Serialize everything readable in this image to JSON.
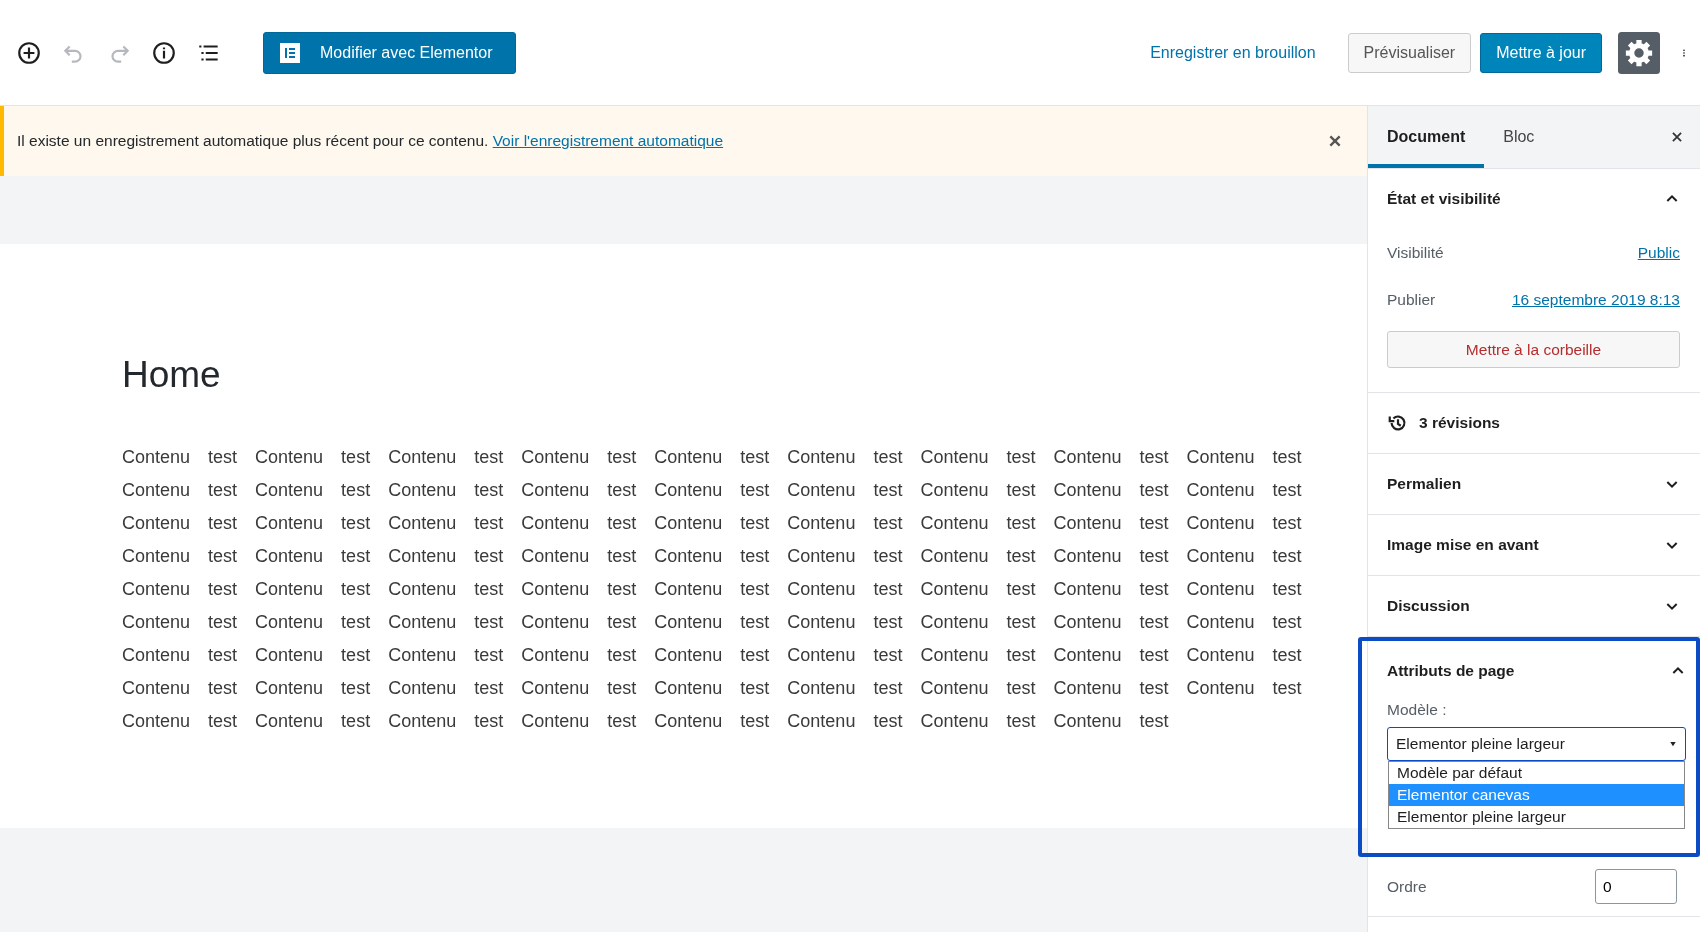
{
  "toolbar": {
    "tools": [
      {
        "kind": "add",
        "disabled": false
      },
      {
        "kind": "undo",
        "disabled": true
      },
      {
        "kind": "redo",
        "disabled": true
      },
      {
        "kind": "info",
        "disabled": false
      },
      {
        "kind": "outline",
        "disabled": false
      }
    ],
    "elementor_button": "Modifier avec Elementor",
    "save_draft": "Enregistrer en brouillon",
    "preview": "Prévisualiser",
    "update": "Mettre à jour",
    "settings_active": true
  },
  "notice": {
    "text": "Il existe un enregistrement automatique plus récent pour ce contenu.",
    "link": "Voir l'enregistrement automatique"
  },
  "post": {
    "title": "Home",
    "lines": [
      "Contenu test Contenu test Contenu test Contenu test Contenu test Contenu test Contenu test Contenu test Contenu test",
      "Contenu test Contenu test Contenu test Contenu test Contenu test Contenu test Contenu test Contenu test Contenu test",
      "Contenu test Contenu test Contenu test Contenu test Contenu test Contenu test Contenu test Contenu test Contenu test",
      "Contenu test Contenu test Contenu test Contenu test Contenu test Contenu test Contenu test Contenu test Contenu test",
      "Contenu test Contenu test Contenu test Contenu test Contenu test Contenu test Contenu test Contenu test Contenu test",
      "Contenu test Contenu test Contenu test Contenu test Contenu test Contenu test Contenu test Contenu test Contenu test",
      "Contenu test Contenu test Contenu test Contenu test Contenu test Contenu test Contenu test Contenu test Contenu test",
      "Contenu test Contenu test Contenu test Contenu test Contenu test Contenu test Contenu test Contenu test Contenu test",
      "Contenu test Contenu test Contenu test Contenu test Contenu test Contenu test Contenu test Contenu test"
    ]
  },
  "sidebar": {
    "tabs": [
      {
        "label": "Document",
        "selected": true
      },
      {
        "label": "Bloc",
        "selected": false
      }
    ],
    "status": {
      "title": "État et visibilité",
      "expanded": true,
      "rows": [
        {
          "label": "Visibilité",
          "value": "Public"
        },
        {
          "label": "Publier",
          "value": "16 septembre 2019 8:13"
        }
      ],
      "trash": "Mettre à la corbeille"
    },
    "revisions": "3 révisions",
    "panels": [
      {
        "title": "Permalien",
        "expanded": false
      },
      {
        "title": "Image mise en avant",
        "expanded": false
      },
      {
        "title": "Discussion",
        "expanded": false
      }
    ],
    "attributes": {
      "title": "Attributs de page",
      "expanded": true,
      "template_label": "Modèle :",
      "template_value": "Elementor pleine largeur",
      "options": [
        {
          "label": "Modèle par défaut",
          "selected": false
        },
        {
          "label": "Elementor canevas",
          "selected": true
        },
        {
          "label": "Elementor pleine largeur",
          "selected": false
        }
      ],
      "order_label": "Ordre",
      "order_value": "0"
    }
  }
}
